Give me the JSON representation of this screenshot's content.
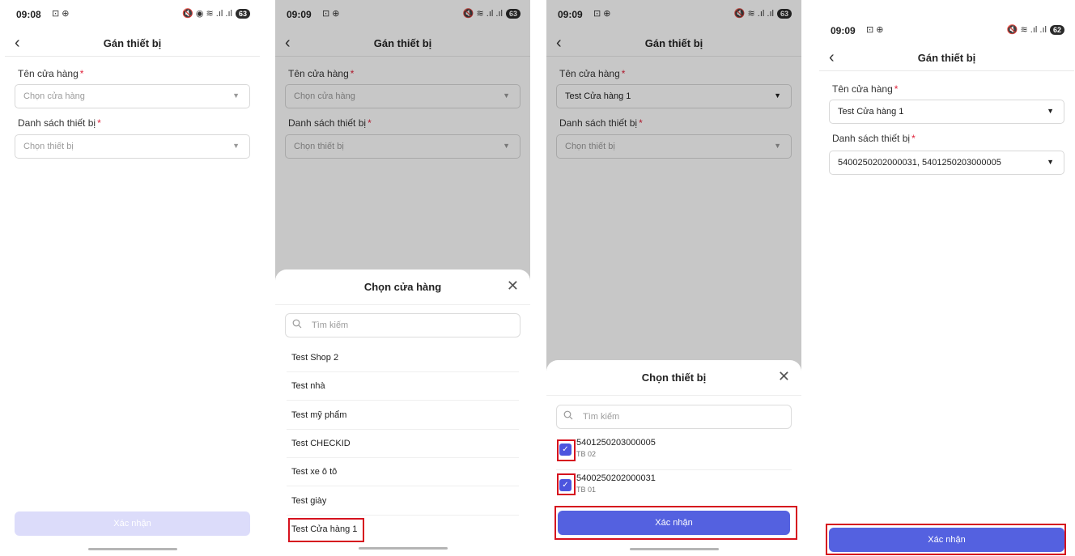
{
  "screens": [
    {
      "time": "09:08",
      "status_icons": "⊡ ⊕",
      "signal": "🔇 ◉ ≋ .ıl .ıl",
      "battery": "63",
      "title": "Gán thiết bị",
      "store_label": "Tên cửa hàng",
      "store_placeholder": "Chọn cửa hàng",
      "device_label": "Danh sách thiết bị",
      "device_placeholder": "Chọn thiết bị",
      "confirm": "Xác nhận"
    },
    {
      "time": "09:09",
      "status_icons": "⊡ ⊕",
      "signal": "🔇 ≋ .ıl .ıl",
      "battery": "63",
      "title": "Gán thiết bị",
      "store_label": "Tên cửa hàng",
      "store_placeholder": "Chọn cửa hàng",
      "device_label": "Danh sách thiết bị",
      "device_placeholder": "Chọn thiết bị",
      "sheet": {
        "title": "Chọn cửa hàng",
        "search_placeholder": "Tìm kiếm",
        "options": [
          "Test Shop 2",
          "Test nhà",
          "Test mỹ phẩm",
          "Test CHECKID",
          "Test  xe ô tô",
          "Test giày",
          "Test Cửa hàng 1"
        ]
      }
    },
    {
      "time": "09:09",
      "status_icons": "⊡ ⊕",
      "signal": "🔇 ≋ .ıl .ıl",
      "battery": "63",
      "title": "Gán thiết bị",
      "store_label": "Tên cửa hàng",
      "store_value": "Test Cửa hàng 1",
      "device_label": "Danh sách thiết bị",
      "device_placeholder": "Chọn thiết bị",
      "sheet": {
        "title": "Chọn thiết bị",
        "search_placeholder": "Tìm kiếm",
        "devices": [
          {
            "serial": "5401250203000005",
            "name": "TB 02"
          },
          {
            "serial": "5400250202000031",
            "name": "TB 01"
          }
        ],
        "confirm": "Xác nhận"
      }
    },
    {
      "time": "09:09",
      "status_icons": "⊡ ⊕",
      "signal": "🔇 ≋ .ıl .ıl",
      "battery": "62",
      "title": "Gán thiết bị",
      "store_label": "Tên cửa hàng",
      "store_value": "Test Cửa hàng 1",
      "device_label": "Danh sách thiết bị",
      "device_value": "5400250202000031, 5401250203000005",
      "confirm": "Xác nhận"
    }
  ],
  "required_mark": "*",
  "colors": {
    "primary": "#5461e0",
    "required": "#e0223a",
    "highlight": "#d6121e"
  }
}
